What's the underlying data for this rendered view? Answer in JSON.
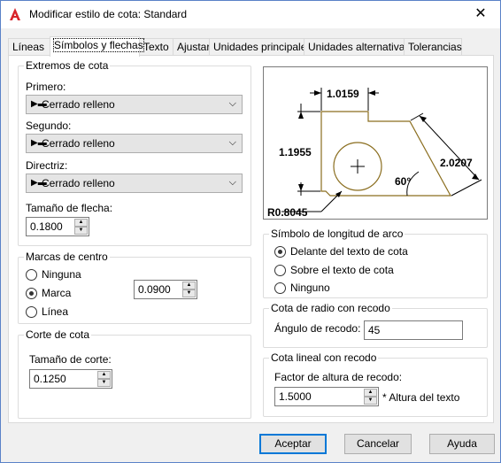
{
  "window": {
    "title": "Modificar estilo de cota: Standard",
    "close_glyph": "✕"
  },
  "tabs": [
    {
      "label": "Líneas"
    },
    {
      "label": "Símbolos y flechas"
    },
    {
      "label": "Texto"
    },
    {
      "label": "Ajustar"
    },
    {
      "label": "Unidades principales"
    },
    {
      "label": "Unidades alternativas"
    },
    {
      "label": "Tolerancias"
    }
  ],
  "arrowheads": {
    "group_label": "Extremos de cota",
    "first": {
      "label": "Primero:",
      "value": "Cerrado relleno"
    },
    "second": {
      "label": "Segundo:",
      "value": "Cerrado relleno"
    },
    "leader": {
      "label": "Directriz:",
      "value": "Cerrado relleno"
    },
    "size": {
      "label": "Tamaño de flecha:",
      "value": "0.1800"
    }
  },
  "center_marks": {
    "group_label": "Marcas de centro",
    "options": [
      {
        "label": "Ninguna",
        "selected": false
      },
      {
        "label": "Marca",
        "selected": true
      },
      {
        "label": "Línea",
        "selected": false
      }
    ],
    "size_value": "0.0900"
  },
  "dim_break": {
    "group_label": "Corte de cota",
    "size_label": "Tamaño de corte:",
    "size_value": "0.1250"
  },
  "preview": {
    "dim_top": "1.0159",
    "dim_left": "1.1955",
    "dim_right": "2.0207",
    "angle": "60°",
    "radius": "R0.8045",
    "outline_color": "#8a6d1e"
  },
  "arc_length": {
    "group_label": "Símbolo de longitud de arco",
    "options": [
      {
        "label": "Delante del texto de cota",
        "selected": true
      },
      {
        "label": "Sobre el texto de cota",
        "selected": false
      },
      {
        "label": "Ninguno",
        "selected": false
      }
    ]
  },
  "radius_jog": {
    "group_label": "Cota de radio con recodo",
    "angle_label": "Ángulo de recodo:",
    "angle_value": "45"
  },
  "linear_jog": {
    "group_label": "Cota lineal con recodo",
    "factor_label": "Factor de altura de recodo:",
    "factor_value": "1.5000",
    "suffix": "* Altura del texto"
  },
  "buttons": {
    "ok": "Aceptar",
    "cancel": "Cancelar",
    "help": "Ayuda"
  }
}
